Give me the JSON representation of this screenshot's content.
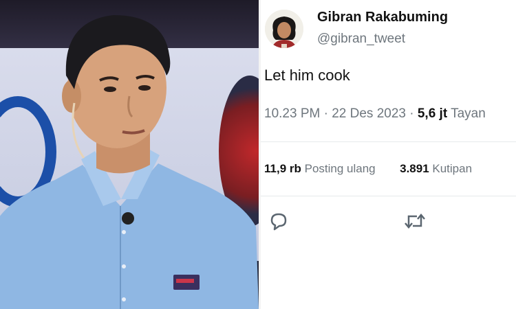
{
  "photo": {
    "subject": "person-photo"
  },
  "tweet": {
    "author_name": "Gibran Rakabuming",
    "author_handle": "@gibran_tweet",
    "text": "Let him cook",
    "time": "10.23 PM",
    "date": "22 Des 2023",
    "views_count": "5,6 jt",
    "views_label": "Tayan",
    "reposts_count": "11,9 rb",
    "reposts_label": "Posting ulang",
    "quotes_count": "3.891",
    "quotes_label": "Kutipan"
  },
  "icons": {
    "reply": "reply-icon",
    "retweet": "retweet-icon"
  },
  "colors": {
    "muted_text": "#6e767d",
    "shirt_blue": "#8fb7e3",
    "background": "#ffffff"
  }
}
